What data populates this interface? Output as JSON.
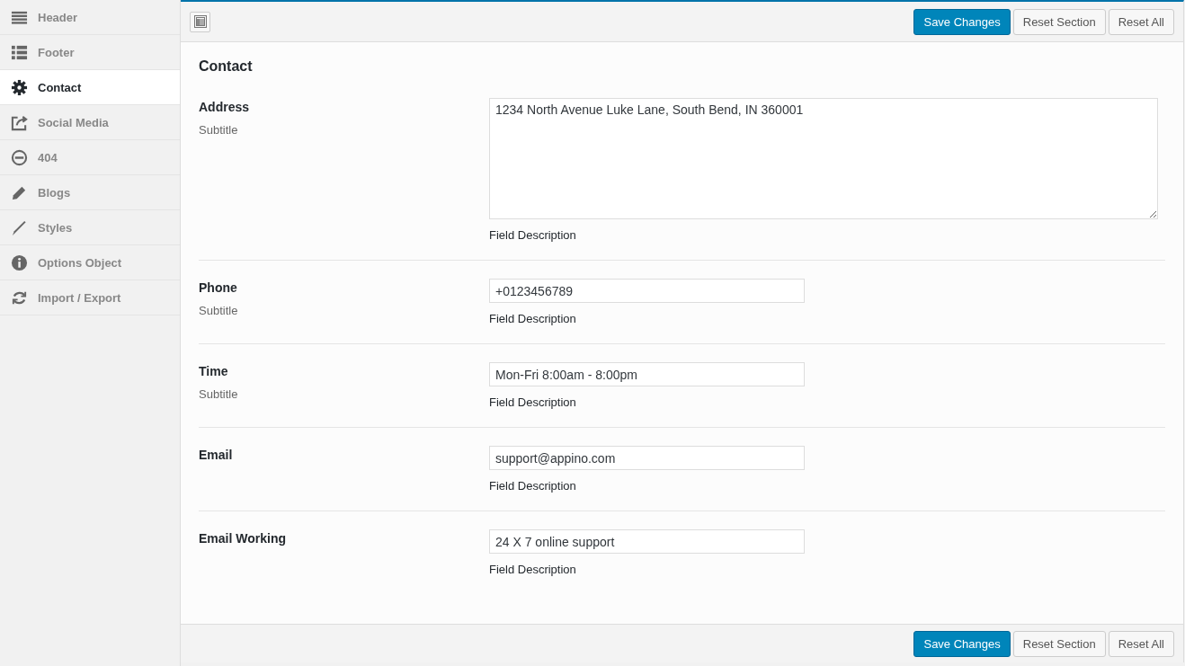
{
  "sidebar": {
    "items": [
      {
        "label": "Header",
        "selected": false
      },
      {
        "label": "Footer",
        "selected": false
      },
      {
        "label": "Contact",
        "selected": true
      },
      {
        "label": "Social Media",
        "selected": false
      },
      {
        "label": "404",
        "selected": false
      },
      {
        "label": "Blogs",
        "selected": false
      },
      {
        "label": "Styles",
        "selected": false
      },
      {
        "label": "Options Object",
        "selected": false
      },
      {
        "label": "Import / Export",
        "selected": false
      }
    ]
  },
  "top_bar": {
    "buttons": [
      {
        "label": "Save Changes",
        "kind": "primary"
      },
      {
        "label": "Reset Section",
        "kind": "secondary"
      },
      {
        "label": "Reset All",
        "kind": "secondary"
      }
    ]
  },
  "section": {
    "title": "Contact",
    "fields": [
      {
        "label": "Address",
        "subtitle": "Subtitle",
        "kind": "textarea",
        "value": "1234 North Avenue Luke Lane, South Bend, IN 360001",
        "description": "Field Description"
      },
      {
        "label": "Phone",
        "subtitle": "Subtitle",
        "kind": "text",
        "value": "+0123456789",
        "description": "Field Description"
      },
      {
        "label": "Time",
        "subtitle": "Subtitle",
        "kind": "text",
        "value": "Mon-Fri 8:00am - 8:00pm",
        "description": "Field Description"
      },
      {
        "label": "Email",
        "kind": "text",
        "value": "support@appino.com",
        "description": "Field Description"
      },
      {
        "label": "Email Working",
        "kind": "text",
        "value": "24 X 7 online support",
        "description": "Field Description"
      }
    ]
  },
  "bottom_bar": {
    "buttons": [
      {
        "label": "Save Changes",
        "kind": "primary"
      },
      {
        "label": "Reset Section",
        "kind": "secondary"
      },
      {
        "label": "Reset All",
        "kind": "secondary"
      }
    ]
  }
}
